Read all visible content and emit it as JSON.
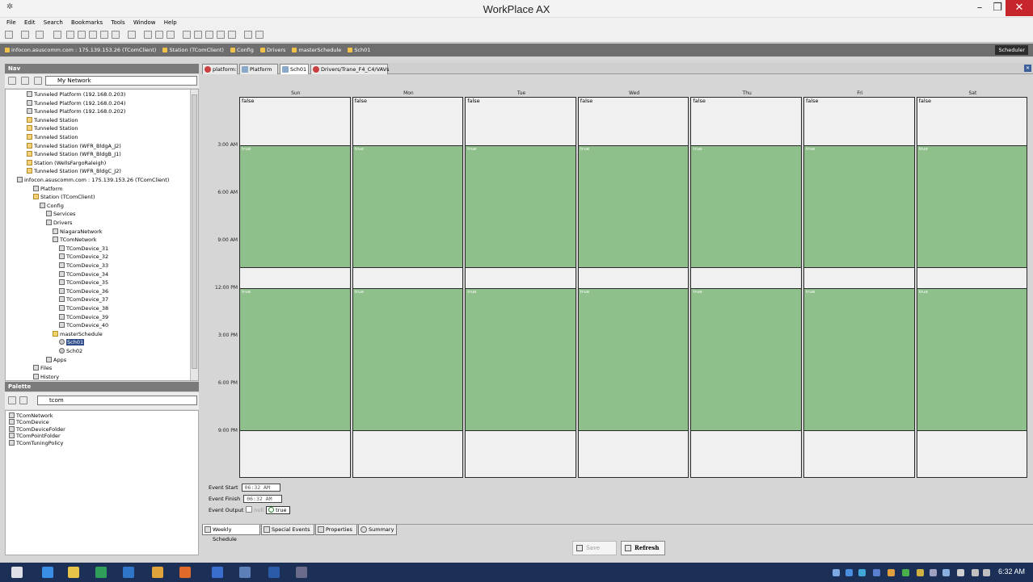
{
  "window": {
    "title": "WorkPlace AX",
    "min_label": "–",
    "max_label": "❐",
    "close_label": "✕"
  },
  "menu": [
    "File",
    "Edit",
    "Search",
    "Bookmarks",
    "Tools",
    "Window",
    "Help"
  ],
  "breadcrumb": [
    "infocon.asuscomm.com : 175.139.153.26 (TComClient)",
    "Station (TComClient)",
    "Config",
    "Drivers",
    "masterSchedule",
    "Sch01"
  ],
  "scheduler_tag": "Scheduler",
  "nav": {
    "title": "Nav",
    "selector": "My Network",
    "tree": [
      {
        "label": "Tunneled Platform (192.168.0.203)",
        "indent": 0,
        "icon": "platform"
      },
      {
        "label": "Tunneled Platform (192.168.0.204)",
        "indent": 0,
        "icon": "platform"
      },
      {
        "label": "Tunneled Platform (192.168.0.202)",
        "indent": 0,
        "icon": "platform"
      },
      {
        "label": "Tunneled Station",
        "indent": 0,
        "icon": "station"
      },
      {
        "label": "Tunneled Station",
        "indent": 0,
        "icon": "station"
      },
      {
        "label": "Tunneled Station",
        "indent": 0,
        "icon": "station"
      },
      {
        "label": "Tunneled Station (WFR_BldgA_J2)",
        "indent": 0,
        "icon": "station"
      },
      {
        "label": "Tunneled Station (WFR_BldgB_J1)",
        "indent": 0,
        "icon": "station"
      },
      {
        "label": "Station (WellsFargoRaleigh)",
        "indent": 0,
        "icon": "station"
      },
      {
        "label": "Tunneled Station (WFR_BldgC_J2)",
        "indent": 0,
        "icon": "station"
      },
      {
        "label": "infocon.asuscomm.com : 175.139.153.26 (TComClient)",
        "indent": -1,
        "icon": "host"
      },
      {
        "label": "Platform",
        "indent": 1,
        "icon": "platform"
      },
      {
        "label": "Station (TComClient)",
        "indent": 1,
        "icon": "station"
      },
      {
        "label": "Config",
        "indent": 2,
        "icon": "config"
      },
      {
        "label": "Services",
        "indent": 3,
        "icon": "service"
      },
      {
        "label": "Drivers",
        "indent": 3,
        "icon": "driver"
      },
      {
        "label": "NiagaraNetwork",
        "indent": 4,
        "icon": "network"
      },
      {
        "label": "TComNetwork",
        "indent": 4,
        "icon": "network"
      },
      {
        "label": "TComDevice_31",
        "indent": 5,
        "icon": "device"
      },
      {
        "label": "TComDevice_32",
        "indent": 5,
        "icon": "device"
      },
      {
        "label": "TComDevice_33",
        "indent": 5,
        "icon": "device"
      },
      {
        "label": "TComDevice_34",
        "indent": 5,
        "icon": "device"
      },
      {
        "label": "TComDevice_35",
        "indent": 5,
        "icon": "device"
      },
      {
        "label": "TComDevice_36",
        "indent": 5,
        "icon": "device"
      },
      {
        "label": "TComDevice_37",
        "indent": 5,
        "icon": "device"
      },
      {
        "label": "TComDevice_38",
        "indent": 5,
        "icon": "device"
      },
      {
        "label": "TComDevice_39",
        "indent": 5,
        "icon": "device"
      },
      {
        "label": "TComDevice_40",
        "indent": 5,
        "icon": "device"
      },
      {
        "label": "masterSchedule",
        "indent": 4,
        "icon": "folder"
      },
      {
        "label": "Sch01",
        "indent": 5,
        "icon": "schedule",
        "selected": true
      },
      {
        "label": "Sch02",
        "indent": 5,
        "icon": "schedule"
      },
      {
        "label": "Apps",
        "indent": 3,
        "icon": "apps"
      },
      {
        "label": "Files",
        "indent": 1,
        "icon": "files"
      },
      {
        "label": "History",
        "indent": 1,
        "icon": "history"
      }
    ]
  },
  "palette": {
    "title": "Palette",
    "selector": "tcom",
    "items": [
      "TComNetwork",
      "TComDevice",
      "TComDeviceFolder",
      "TComPointFolder",
      "TComTuningPolicy"
    ]
  },
  "view_tabs": [
    "platform:",
    "Platform",
    "Sch01",
    "Drivers/Trane_F4_C4/VAVs"
  ],
  "schedule": {
    "days": [
      "Sun",
      "Mon",
      "Tue",
      "Wed",
      "Thu",
      "Fri",
      "Sat"
    ],
    "hours": [
      "3:00 AM",
      "6:00 AM",
      "9:00 AM",
      "12:00 PM",
      "3:00 PM",
      "6:00 PM",
      "9:00 PM"
    ],
    "default_label": "false",
    "events": [
      {
        "start_hour": 3.0,
        "end_hour": 10.75,
        "label": "true"
      },
      {
        "start_hour": 12.0,
        "end_hour": 21.0,
        "label": "true"
      }
    ],
    "active_color": "#8fbf8b"
  },
  "event": {
    "start_label": "Event Start",
    "start_value": "06:32 AM",
    "finish_label": "Event Finish",
    "finish_value": "06:32 AM",
    "output_label": "Event Output",
    "null_label": "null",
    "true_label": "true"
  },
  "bottom_tabs": [
    "Weekly Schedule",
    "Special Events",
    "Properties",
    "Summary"
  ],
  "buttons": {
    "save": "Save",
    "refresh": "Refresh"
  },
  "taskbar": {
    "clock": "6:32 AM"
  }
}
